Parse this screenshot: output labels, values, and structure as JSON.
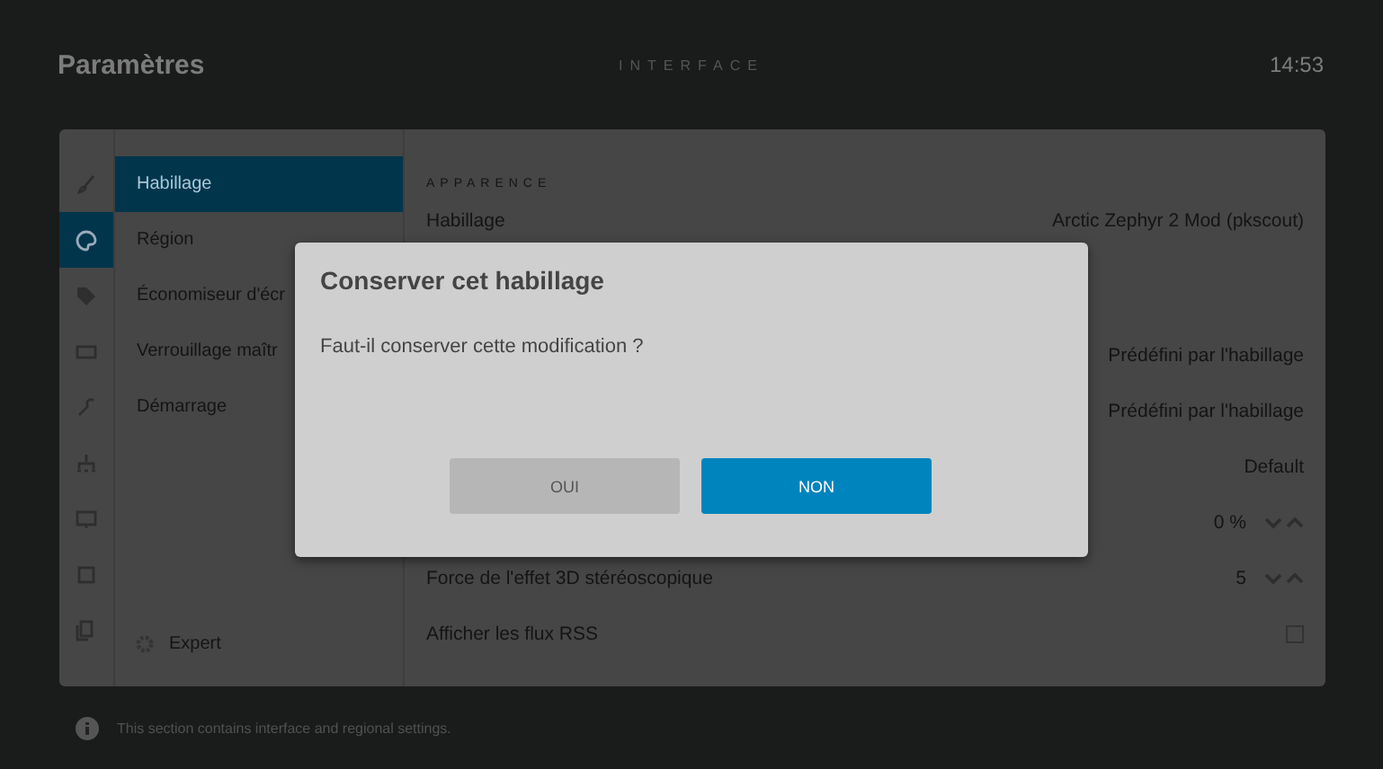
{
  "header": {
    "title": "Paramètres",
    "section": "INTERFACE",
    "time": "14:53"
  },
  "rail": [
    {
      "selected": false
    },
    {
      "selected": true
    },
    {
      "selected": false
    },
    {
      "selected": false
    },
    {
      "selected": false
    },
    {
      "selected": false
    },
    {
      "selected": false
    },
    {
      "selected": false
    },
    {
      "selected": false
    }
  ],
  "categories": [
    {
      "label": "Habillage",
      "selected": true
    },
    {
      "label": "Région",
      "selected": false
    },
    {
      "label": "Économiseur d'écr",
      "selected": false
    },
    {
      "label": "Verrouillage maîtr",
      "selected": false
    },
    {
      "label": "Démarrage",
      "selected": false
    }
  ],
  "level_button": {
    "label": "Expert"
  },
  "group_title": "APPARENCE",
  "settings": [
    {
      "kind": "value",
      "label": "Habillage",
      "value": "Arctic Zephyr 2 Mod (pkscout)"
    },
    {
      "kind": "covered"
    },
    {
      "kind": "value",
      "value": "Prédéfini par l'habillage"
    },
    {
      "kind": "value",
      "value": "Prédéfini par l'habillage"
    },
    {
      "kind": "value",
      "value": "Default"
    },
    {
      "kind": "spinner",
      "value": "0 %"
    },
    {
      "kind": "spinner",
      "label": "Force de l'effet 3D stéréoscopique",
      "value": "5"
    },
    {
      "kind": "toggle",
      "label": "Afficher les flux RSS",
      "checked": false
    }
  ],
  "dialog": {
    "title": "Conserver cet habillage",
    "message": "Faut-il conserver cette modification ?",
    "buttons": [
      {
        "label": "OUI",
        "selected": false
      },
      {
        "label": "NON",
        "selected": true
      }
    ]
  },
  "footer": {
    "text": "This section contains interface and regional settings."
  }
}
